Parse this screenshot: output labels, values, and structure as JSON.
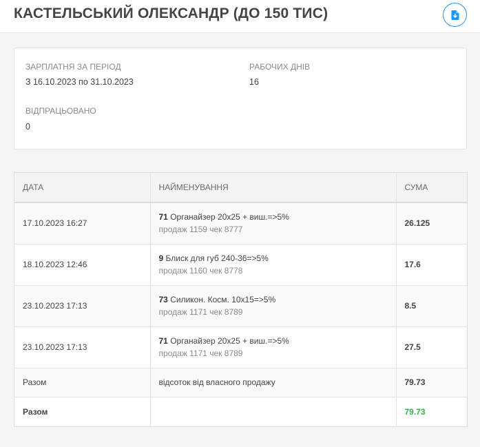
{
  "header": {
    "title": "КАСТЕЛЬСЬКИЙ ОЛЕКСАНДР (ДО 150 ТИС)",
    "export_icon": "file-download-icon",
    "accent_color": "#2196f3"
  },
  "info": {
    "period_label": "ЗАРПЛАТНЯ ЗА ПЕРІОД",
    "period_value": "З 16.10.2023 по 31.10.2023",
    "workdays_label": "РАБОЧИХ ДНІВ",
    "workdays_value": "16",
    "worked_label": "ВІДПРАЦЬОВАНО",
    "worked_value": "0"
  },
  "table": {
    "columns": [
      "ДАТА",
      "НАЙМЕНУВАННЯ",
      "СУМА"
    ],
    "rows": [
      {
        "date": "17.10.2023 16:27",
        "qty": "71",
        "name": "Органайзер 20х25 + виш.=>5%",
        "sub": "продаж 1159 чек 8777",
        "amount": "26.125"
      },
      {
        "date": "18.10.2023 12:46",
        "qty": "9",
        "name": "Блиск для губ 240-36=>5%",
        "sub": "продаж 1160 чек 8778",
        "amount": "17.6"
      },
      {
        "date": "23.10.2023 17:13",
        "qty": "73",
        "name": "Силикон. Косм. 10х15=>5%",
        "sub": "продаж 1171 чек 8789",
        "amount": "8.5"
      },
      {
        "date": "23.10.2023 17:13",
        "qty": "71",
        "name": "Органайзер 20х25 + виш.=>5%",
        "sub": "продаж 1171 чек 8789",
        "amount": "27.5"
      }
    ],
    "subtotal": {
      "label": "Разом",
      "desc": "відсоток від власного продажу",
      "amount": "79.73"
    },
    "total": {
      "label": "Разом",
      "amount": "79.73",
      "amount_color": "#35b34a"
    }
  }
}
